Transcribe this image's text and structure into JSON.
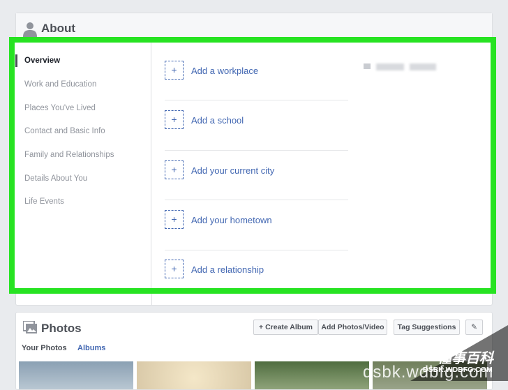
{
  "about": {
    "title": "About",
    "sidebar": [
      {
        "label": "Overview",
        "active": true
      },
      {
        "label": "Work and Education"
      },
      {
        "label": "Places You've Lived"
      },
      {
        "label": "Contact and Basic Info"
      },
      {
        "label": "Family and Relationships"
      },
      {
        "label": "Details About You"
      },
      {
        "label": "Life Events"
      }
    ],
    "add_items": [
      {
        "plus": "+",
        "label": "Add a workplace"
      },
      {
        "plus": "+",
        "label": "Add a school"
      },
      {
        "plus": "+",
        "label": "Add your current city"
      },
      {
        "plus": "+",
        "label": "Add your hometown"
      },
      {
        "plus": "+",
        "label": "Add a relationship"
      }
    ]
  },
  "photos": {
    "title": "Photos",
    "buttons": {
      "create_album": "+ Create Album",
      "add_photos": "Add Photos/Video",
      "tag_suggestions": "Tag Suggestions",
      "edit": "✎"
    },
    "tabs": {
      "your_photos": "Your Photos",
      "albums": "Albums"
    }
  },
  "watermark": {
    "title": "懂事百科",
    "url": "DSBK.WDBFG.COM",
    "url_large": "dsbk.wdbfg.com"
  },
  "colors": {
    "highlight": "#27e322",
    "link": "#4267b2",
    "background": "#e9ebee"
  }
}
